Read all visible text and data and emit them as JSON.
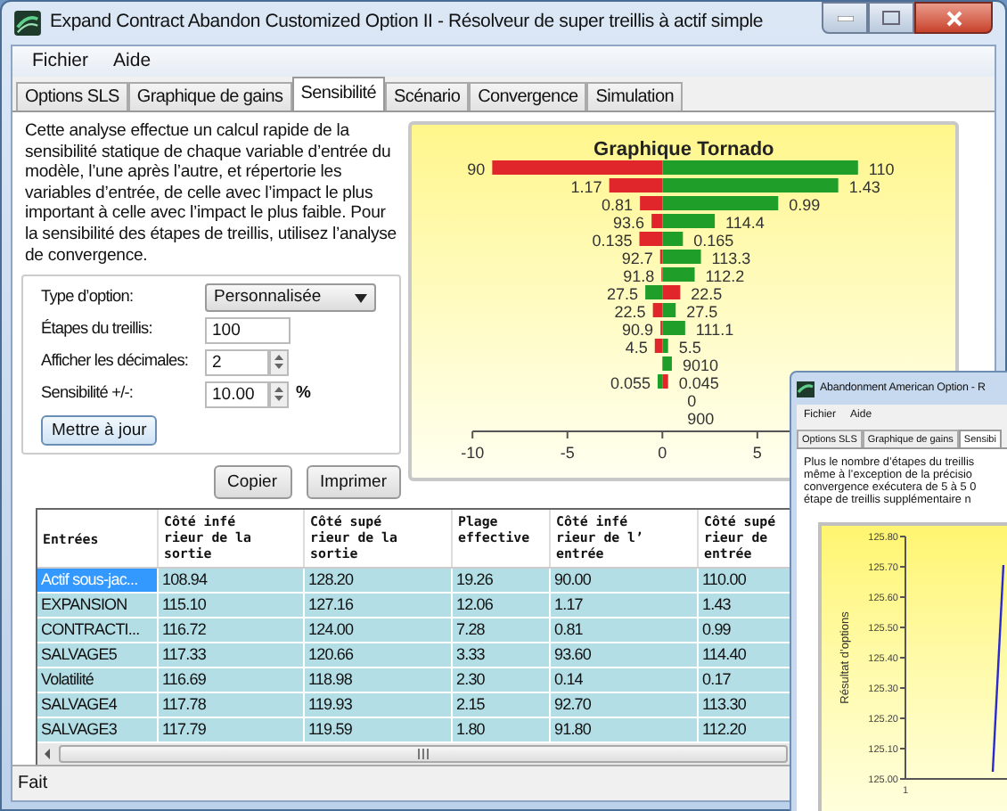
{
  "window": {
    "title": "Expand Contract Abandon Customized Option II - Résolveur de super treillis à actif simple",
    "menu": [
      "Fichier",
      "Aide"
    ]
  },
  "tabs": [
    {
      "label": "Options SLS",
      "selected": false
    },
    {
      "label": "Graphique de gains",
      "selected": false
    },
    {
      "label": "Sensibilité",
      "selected": true
    },
    {
      "label": "Scénario",
      "selected": false
    },
    {
      "label": "Convergence",
      "selected": false
    },
    {
      "label": "Simulation",
      "selected": false
    }
  ],
  "description": "Cette analyse effectue un calcul rapide de la sensibilité statique de chaque variable d’entrée du modèle, l’une après l’autre, et répertorie les variables d’entrée, de celle avec l’impact le plus important à celle avec l’impact le plus faible. Pour la sensibilité des étapes de treillis, utilisez l’analyse de convergence.",
  "form": {
    "fields": [
      {
        "kind": "select",
        "label": "Type d’option:",
        "value": "Personnalisée"
      },
      {
        "kind": "text",
        "label": "Étapes du treillis:",
        "value": "100"
      },
      {
        "kind": "spin",
        "label": "Afficher les décimales:",
        "value": "2"
      },
      {
        "kind": "spin",
        "label": "Sensibilité +/-:",
        "value": "10.00",
        "unit": "%"
      }
    ],
    "update_button": "Mettre à jour"
  },
  "buttons": [
    "Copier",
    "Imprimer"
  ],
  "tornado": {
    "row_labels": [
      {
        "low": "90",
        "high": "110"
      },
      {
        "low": "1.17",
        "high": "1.43"
      },
      {
        "low": "0.81",
        "high": "0.99"
      },
      {
        "low": "93.6",
        "high": "114.4"
      },
      {
        "low": "0.135",
        "high": "0.165"
      },
      {
        "low": "92.7",
        "high": "113.3"
      },
      {
        "low": "91.8",
        "high": "112.2"
      },
      {
        "low": "27.5",
        "high": "22.5"
      },
      {
        "low": "22.5",
        "high": "27.5"
      },
      {
        "low": "90.9",
        "high": "111.1"
      },
      {
        "low": "4.5",
        "high": "5.5"
      },
      {
        "high": "9010"
      },
      {
        "low": "0.055",
        "high": "0.045"
      },
      {
        "high": "0"
      },
      {
        "high": "900"
      }
    ],
    "chart_data": {
      "type": "bar",
      "orientation": "horizontal",
      "stacked": true,
      "title": "Graphique Tornado",
      "xlim": [
        -13.2,
        15.8
      ],
      "xticks": [
        -10,
        -5,
        0,
        5
      ],
      "categories": [
        null,
        null,
        null,
        null,
        null,
        null,
        null,
        null,
        null,
        null,
        null,
        null,
        null
      ],
      "series": [
        {
          "color": "#e0262b",
          "values": [
            -8.96,
            -2.8,
            -1.18,
            -0.57,
            -1.21,
            -0.12,
            -0.05,
            0.94,
            -0.5,
            -0.1,
            -0.4,
            0,
            0.3
          ]
        },
        {
          "color": "#1f9e2a",
          "values": [
            10.3,
            9.26,
            6.1,
            2.76,
            1.08,
            2.03,
            1.7,
            -0.9,
            0.7,
            1.2,
            0.3,
            0.5,
            -0.25
          ]
        }
      ]
    }
  },
  "table": {
    "columns": [
      "Entrées",
      "Côté infé\nrieur de la\nsortie",
      "Côté supé\nrieur de la\nsortie",
      "Plage\neffective",
      "Côté infé\nrieur de l’\nentrée",
      "Côté supé\nrieur de\nentrée"
    ],
    "rows": [
      {
        "selected": true,
        "cells": [
          "Actif sous-jac...",
          "108.94",
          "128.20",
          "19.26",
          "90.00",
          "110.00"
        ]
      },
      {
        "selected": false,
        "cells": [
          "EXPANSION",
          "115.10",
          "127.16",
          "12.06",
          "1.17",
          "1.43"
        ]
      },
      {
        "selected": false,
        "cells": [
          "CONTRACTI...",
          "116.72",
          "124.00",
          "7.28",
          "0.81",
          "0.99"
        ]
      },
      {
        "selected": false,
        "cells": [
          "SALVAGE5",
          "117.33",
          "120.66",
          "3.33",
          "93.60",
          "114.40"
        ]
      },
      {
        "selected": false,
        "cells": [
          "Volatilité",
          "116.69",
          "118.98",
          "2.30",
          "0.14",
          "0.17"
        ]
      },
      {
        "selected": false,
        "cells": [
          "SALVAGE4",
          "117.78",
          "119.93",
          "2.15",
          "92.70",
          "113.30"
        ]
      },
      {
        "selected": false,
        "cells": [
          "SALVAGE3",
          "117.79",
          "119.59",
          "1.80",
          "91.80",
          "112.20"
        ]
      }
    ]
  },
  "status_bar": "Fait",
  "second_window": {
    "title": "Abandonment American Option - R",
    "menu": [
      "Fichier",
      "Aide"
    ],
    "tabs": [
      {
        "label": "Options SLS",
        "selected": false
      },
      {
        "label": "Graphique de gains",
        "selected": false
      },
      {
        "label": "Sensibi",
        "selected": true
      }
    ],
    "text_lines": [
      "Plus le nombre d’étapes du treillis",
      "même à l’exception de la précisio",
      "convergence exécutera de 5 à 5 0",
      "étape de treillis supplémentaire n"
    ],
    "convergence_chart": {
      "ylabel": "Résultat d’options",
      "x_tick_labels": [
        "1"
      ],
      "y_tick_labels": [
        "125.80",
        "125.70",
        "125.60",
        "125.50",
        "125.40",
        "125.30",
        "125.20",
        "125.10",
        "125.00"
      ]
    }
  }
}
